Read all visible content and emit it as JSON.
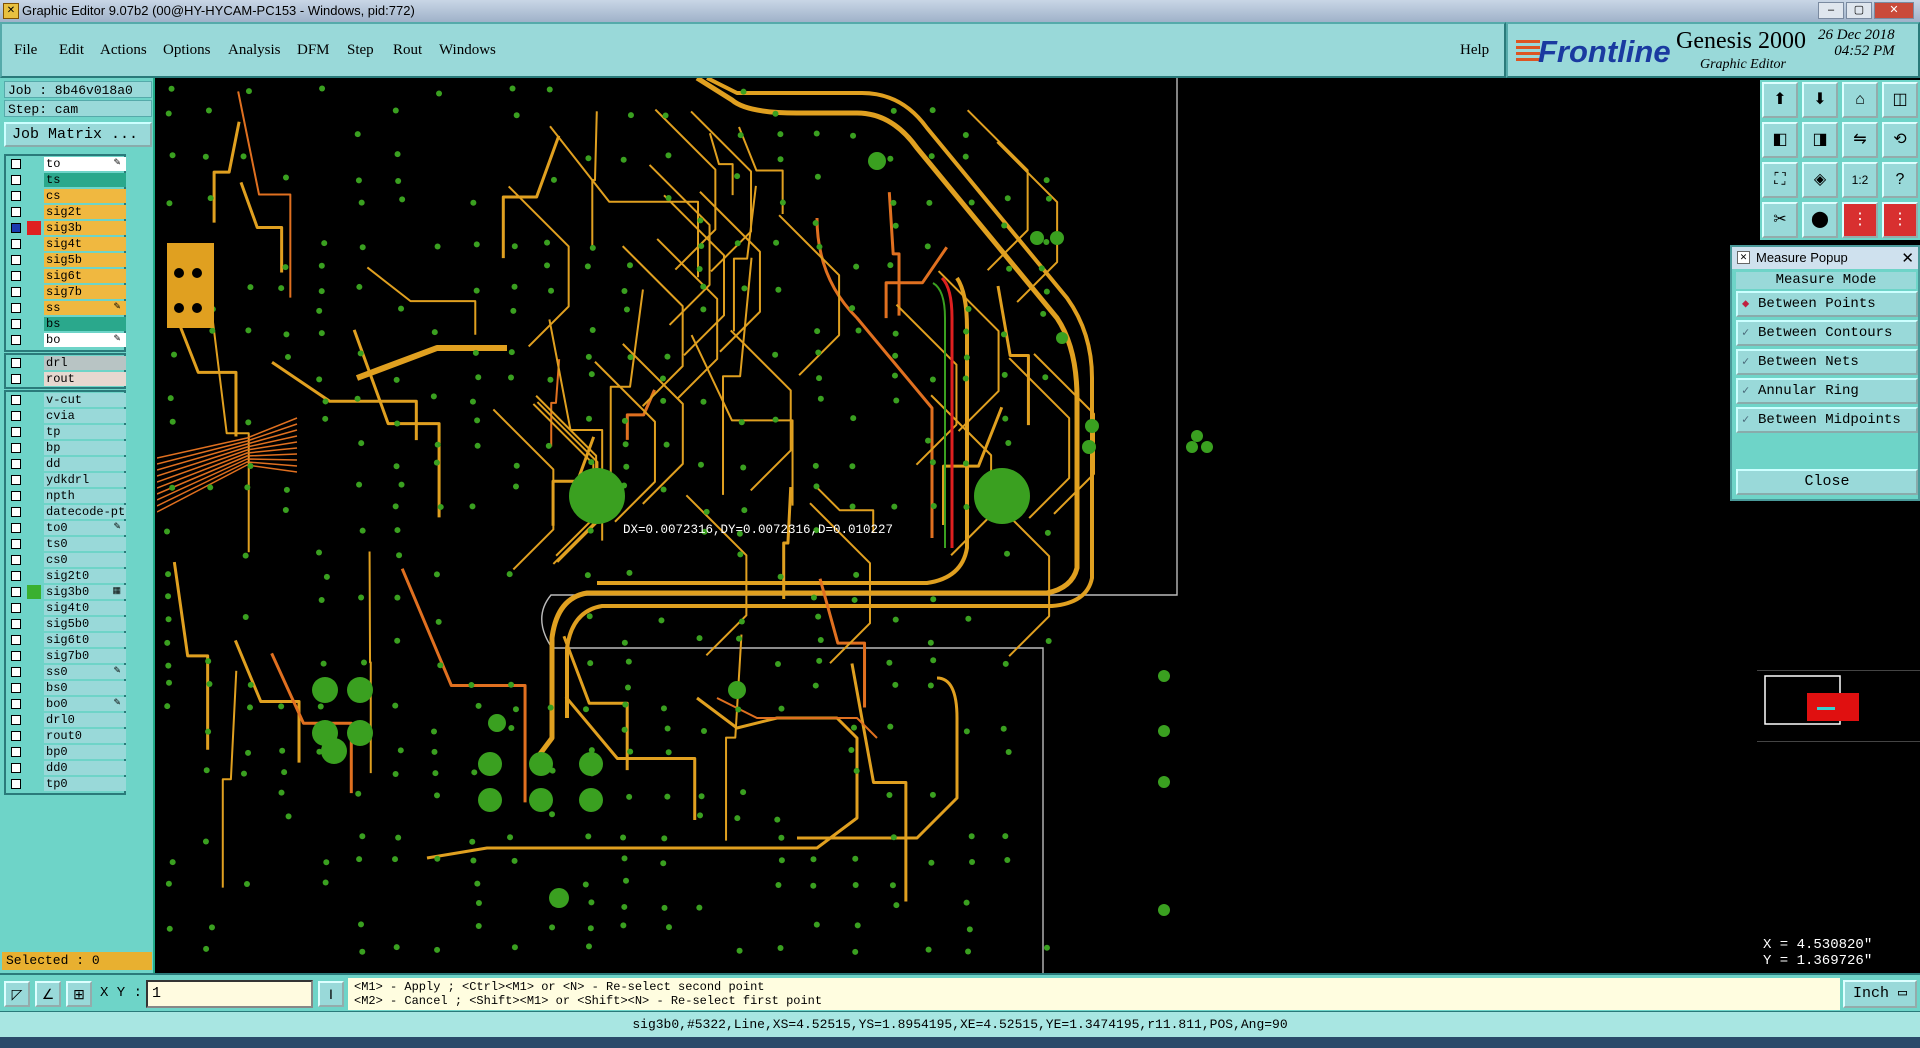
{
  "window": {
    "title": "Graphic Editor 9.07b2 (00@HY-HYCAM-PC153 - Windows, pid:772)"
  },
  "menu": {
    "items": [
      "File",
      "Edit",
      "Actions",
      "Options",
      "Analysis",
      "DFM",
      "Step",
      "Rout",
      "Windows"
    ],
    "help": "Help"
  },
  "brand": {
    "logo": "Frontline",
    "product": "Genesis 2000",
    "subtitle": "Graphic Editor",
    "date": "26 Dec 2018",
    "time": "04:52 PM"
  },
  "job": {
    "job_label": "Job : 8b46v018a0",
    "step_label": "Step: cam",
    "matrix_button": "Job Matrix ..."
  },
  "layers_group1": [
    {
      "name": "to",
      "color": "#ffffff",
      "icon": "pen"
    },
    {
      "name": "ts",
      "color": "#2aa88c"
    },
    {
      "name": "cs",
      "color": "#f0b840"
    },
    {
      "name": "sig2t",
      "color": "#f0b840"
    },
    {
      "name": "sig3b",
      "color": "#f0b840",
      "checked": true,
      "swatch": "#e02020"
    },
    {
      "name": "sig4t",
      "color": "#f0b840"
    },
    {
      "name": "sig5b",
      "color": "#f0b840"
    },
    {
      "name": "sig6t",
      "color": "#f0b840"
    },
    {
      "name": "sig7b",
      "color": "#f0b840"
    },
    {
      "name": "ss",
      "color": "#f0b840",
      "icon": "pen"
    },
    {
      "name": "bs",
      "color": "#2aa88c"
    },
    {
      "name": "bo",
      "color": "#ffffff",
      "icon": "pen"
    }
  ],
  "layers_group2": [
    {
      "name": "drl",
      "color": "#b8c4c4"
    },
    {
      "name": "rout",
      "color": "#e6d8d0"
    }
  ],
  "layers_group3": [
    {
      "name": "v-cut"
    },
    {
      "name": "cvia"
    },
    {
      "name": "tp"
    },
    {
      "name": "bp"
    },
    {
      "name": "dd"
    },
    {
      "name": "ydkdrl"
    },
    {
      "name": "npth"
    },
    {
      "name": "datecode-pt"
    },
    {
      "name": "to0",
      "icon": "pen"
    },
    {
      "name": "ts0"
    },
    {
      "name": "cs0"
    },
    {
      "name": "sig2t0"
    },
    {
      "name": "sig3b0",
      "swatch": "#3ab030",
      "icon": "grid"
    },
    {
      "name": "sig4t0"
    },
    {
      "name": "sig5b0"
    },
    {
      "name": "sig6t0"
    },
    {
      "name": "sig7b0"
    },
    {
      "name": "ss0",
      "icon": "pen"
    },
    {
      "name": "bs0"
    },
    {
      "name": "bo0",
      "icon": "pen"
    },
    {
      "name": "drl0"
    },
    {
      "name": "rout0"
    },
    {
      "name": "bp0"
    },
    {
      "name": "dd0"
    },
    {
      "name": "tp0"
    }
  ],
  "selected_label": "Selected : 0",
  "canvas": {
    "measure_readout": "DX=0.0072316,DY=0.0072316,D=0.010227"
  },
  "measure_popup": {
    "title": "Measure Popup",
    "mode_label": "Measure Mode",
    "options": [
      "Between Points",
      "Between Contours",
      "Between Nets",
      "Annular Ring",
      "Between Midpoints"
    ],
    "selected_option": "Between Points",
    "close_label": "Close"
  },
  "toolbar_icons": [
    "zoom-home-icon",
    "snapshot-icon",
    "home-icon",
    "layout-icon",
    "pan-left-icon",
    "pan-right-icon",
    "zoom-step-icon",
    "redraw-icon",
    "fit-icon",
    "zoom-box-icon",
    "ratio-1-2-icon",
    "help-icon",
    "measure-icon",
    "cut-icon",
    "net-icon",
    "align-icon"
  ],
  "toolbar_texts": {
    "ratio": "1:2",
    "help": "?"
  },
  "coords": {
    "x": "X = 4.530820\"",
    "y": "Y = 1.369726\""
  },
  "bottom": {
    "xy_label": "X Y :",
    "xy_value": "1",
    "msg_line1": "<M1> - Apply  ; <Ctrl><M1> or <N> - Re-select second point",
    "msg_line2": "<M2> - Cancel ; <Shift><M1> or <Shift><N> - Re-select first point",
    "unit": "Inch"
  },
  "status": "sig3b0,#5322,Line,XS=4.52515,YS=1.8954195,XE=4.52515,YE=1.3474195,r11.811,POS,Ang=90",
  "colors": {
    "panel": "#6ed4c8",
    "button": "#99d9d9",
    "trace": "#e0a020",
    "pad": "#3aa020",
    "highlight": "#e02020"
  }
}
